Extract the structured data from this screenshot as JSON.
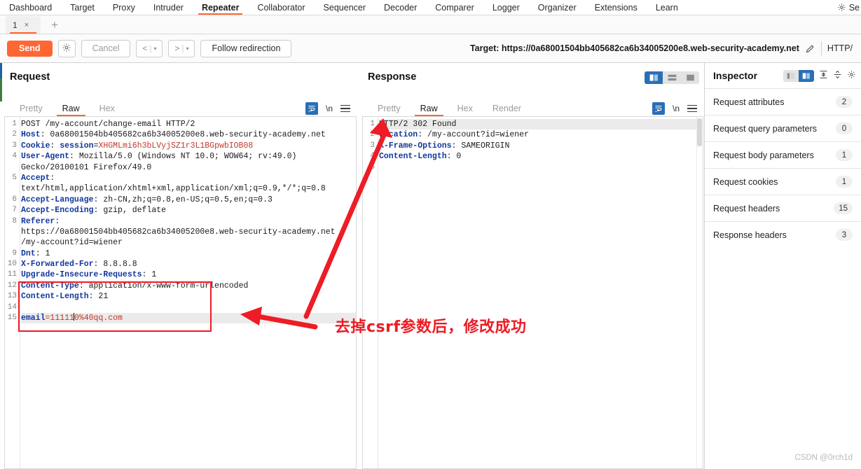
{
  "app": {
    "main_tabs": [
      {
        "label": "Dashboard",
        "active": false
      },
      {
        "label": "Target",
        "active": false
      },
      {
        "label": "Proxy",
        "active": false
      },
      {
        "label": "Intruder",
        "active": false
      },
      {
        "label": "Repeater",
        "active": true
      },
      {
        "label": "Collaborator",
        "active": false
      },
      {
        "label": "Sequencer",
        "active": false
      },
      {
        "label": "Decoder",
        "active": false
      },
      {
        "label": "Comparer",
        "active": false
      },
      {
        "label": "Logger",
        "active": false
      },
      {
        "label": "Organizer",
        "active": false
      },
      {
        "label": "Extensions",
        "active": false
      },
      {
        "label": "Learn",
        "active": false
      }
    ],
    "settings_label": "Se",
    "settings_icon": "gear-icon"
  },
  "repeater_tabs": {
    "tabs": [
      {
        "label": "1",
        "close": "×"
      }
    ],
    "add_label": "+"
  },
  "toolbar": {
    "send_label": "Send",
    "settings_icon": "gear-icon",
    "cancel_label": "Cancel",
    "back_label": "<",
    "forward_label": ">",
    "caret": "▾",
    "follow_redirection_label": "Follow redirection",
    "target_label": "Target: https://0a68001504bb405682ca6b34005200e8.web-security-academy.net",
    "edit_icon": "pencil-icon",
    "http_version": "HTTP/"
  },
  "request": {
    "title": "Request",
    "tabs": [
      {
        "label": "Pretty",
        "active": false
      },
      {
        "label": "Raw",
        "active": true
      },
      {
        "label": "Hex",
        "active": false
      }
    ],
    "wrap_icon": "word-wrap-icon",
    "newline_label": "\\n",
    "menu_icon": "hamburger-icon",
    "lines": [
      {
        "n": "1",
        "segments": [
          {
            "t": "POST /my-account/change-email HTTP/2",
            "c": "val"
          }
        ]
      },
      {
        "n": "2",
        "segments": [
          {
            "t": "Host",
            "c": "hdr"
          },
          {
            "t": ": 0a68001504bb405682ca6b34005200e8.web-security-academy.net",
            "c": "val"
          }
        ]
      },
      {
        "n": "3",
        "segments": [
          {
            "t": "Cookie",
            "c": "hdr"
          },
          {
            "t": ": ",
            "c": "val"
          },
          {
            "t": "session",
            "c": "hdr"
          },
          {
            "t": "=",
            "c": "val"
          },
          {
            "t": "XHGMLmi6h3bLVyjSZ1r3L1BGpwbIOB08",
            "c": "red"
          }
        ]
      },
      {
        "n": "4",
        "segments": [
          {
            "t": "User-Agent",
            "c": "hdr"
          },
          {
            "t": ": Mozilla/5.0 (Windows NT 10.0; WOW64; rv:49.0)",
            "c": "val"
          }
        ]
      },
      {
        "n": "",
        "segments": [
          {
            "t": "Gecko/20100101 Firefox/49.0",
            "c": "val"
          }
        ]
      },
      {
        "n": "5",
        "segments": [
          {
            "t": "Accept",
            "c": "hdr"
          },
          {
            "t": ":",
            "c": "val"
          }
        ]
      },
      {
        "n": "",
        "segments": [
          {
            "t": "text/html,application/xhtml+xml,application/xml;q=0.9,*/*;q=0.8",
            "c": "val"
          }
        ]
      },
      {
        "n": "6",
        "segments": [
          {
            "t": "Accept-Language",
            "c": "hdr"
          },
          {
            "t": ": zh-CN,zh;q=0.8,en-US;q=0.5,en;q=0.3",
            "c": "val"
          }
        ]
      },
      {
        "n": "7",
        "segments": [
          {
            "t": "Accept-Encoding",
            "c": "hdr"
          },
          {
            "t": ": gzip, deflate",
            "c": "val"
          }
        ]
      },
      {
        "n": "8",
        "segments": [
          {
            "t": "Referer",
            "c": "hdr"
          },
          {
            "t": ":",
            "c": "val"
          }
        ]
      },
      {
        "n": "",
        "segments": [
          {
            "t": "https://0a68001504bb405682ca6b34005200e8.web-security-academy.net",
            "c": "val"
          }
        ]
      },
      {
        "n": "",
        "segments": [
          {
            "t": "/my-account?id=wiener",
            "c": "val"
          }
        ]
      },
      {
        "n": "9",
        "segments": [
          {
            "t": "Dnt",
            "c": "hdr"
          },
          {
            "t": ": 1",
            "c": "val"
          }
        ]
      },
      {
        "n": "10",
        "segments": [
          {
            "t": "X-Forwarded-For",
            "c": "hdr"
          },
          {
            "t": ": 8.8.8.8",
            "c": "val"
          }
        ]
      },
      {
        "n": "11",
        "segments": [
          {
            "t": "Upgrade-Insecure-Requests",
            "c": "hdr"
          },
          {
            "t": ": 1",
            "c": "val"
          }
        ]
      },
      {
        "n": "12",
        "segments": [
          {
            "t": "Content-Type",
            "c": "hdr"
          },
          {
            "t": ": application/x-www-form-urlencoded",
            "c": "val"
          }
        ]
      },
      {
        "n": "13",
        "segments": [
          {
            "t": "Content-Length",
            "c": "hdr"
          },
          {
            "t": ": 21",
            "c": "val"
          }
        ]
      },
      {
        "n": "14",
        "segments": [
          {
            "t": "",
            "c": "val"
          }
        ]
      },
      {
        "n": "15",
        "highlight": true,
        "caret_after": 1,
        "segments": [
          {
            "t": "email",
            "c": "hdr"
          },
          {
            "t": "=11111",
            "c": "red"
          },
          {
            "t": "0%40qq.com",
            "c": "red"
          }
        ]
      }
    ]
  },
  "response": {
    "title": "Response",
    "tabs": [
      {
        "label": "Pretty",
        "active": false
      },
      {
        "label": "Raw",
        "active": true
      },
      {
        "label": "Hex",
        "active": false
      },
      {
        "label": "Render",
        "active": false
      }
    ],
    "wrap_icon": "word-wrap-icon",
    "newline_label": "\\n",
    "menu_icon": "hamburger-icon",
    "lines": [
      {
        "n": "1",
        "highlight": true,
        "segments": [
          {
            "t": "HTTP/2 302 Found",
            "c": "val"
          }
        ]
      },
      {
        "n": "2",
        "segments": [
          {
            "t": "Location",
            "c": "hdr"
          },
          {
            "t": ": /my-account?id=wiener",
            "c": "val"
          }
        ]
      },
      {
        "n": "3",
        "segments": [
          {
            "t": "X-Frame-Options",
            "c": "hdr"
          },
          {
            "t": ": SAMEORIGIN",
            "c": "val"
          }
        ]
      },
      {
        "n": "4",
        "segments": [
          {
            "t": "Content-Length",
            "c": "hdr"
          },
          {
            "t": ": 0",
            "c": "val"
          }
        ]
      },
      {
        "n": "5",
        "segments": [
          {
            "t": "",
            "c": "val"
          }
        ]
      }
    ]
  },
  "inspector": {
    "title": "Inspector",
    "layout_icon_left": "columns-left-icon",
    "layout_icon_right": "columns-right-icon",
    "expand_icon": "expand-all-icon",
    "collapse_icon": "collapse-all-icon",
    "settings_icon": "gear-icon",
    "rows": [
      {
        "label": "Request attributes",
        "count": "2"
      },
      {
        "label": "Request query parameters",
        "count": "0"
      },
      {
        "label": "Request body parameters",
        "count": "1"
      },
      {
        "label": "Request cookies",
        "count": "1"
      },
      {
        "label": "Request headers",
        "count": "15"
      },
      {
        "label": "Response headers",
        "count": "3"
      }
    ]
  },
  "annotations": {
    "note": "去掉csrf参数后，修改成功",
    "color": "#ee1c25",
    "watermark": "CSDN @0rch1d"
  },
  "colors": {
    "accent": "#ff6633",
    "blue": "#2a6fb5",
    "header_blue": "#12379c",
    "value_red": "#c0392b",
    "annotation_red": "#ee1c25"
  }
}
